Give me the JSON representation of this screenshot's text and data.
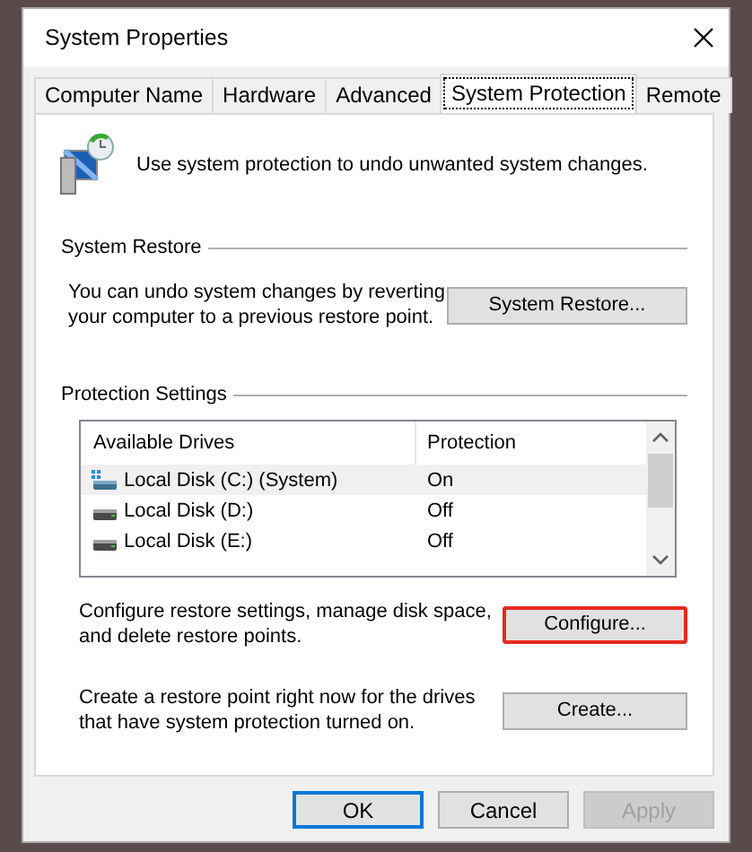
{
  "window": {
    "title": "System Properties"
  },
  "tabs": [
    {
      "label": "Computer Name",
      "selected": false
    },
    {
      "label": "Hardware",
      "selected": false
    },
    {
      "label": "Advanced",
      "selected": false
    },
    {
      "label": "System Protection",
      "selected": true
    },
    {
      "label": "Remote",
      "selected": false
    }
  ],
  "intro": "Use system protection to undo unwanted system changes.",
  "system_restore": {
    "heading": "System Restore",
    "text": "You can undo system changes by reverting your computer to a previous restore point.",
    "button": "System Restore..."
  },
  "protection_settings": {
    "heading": "Protection Settings",
    "columns": [
      "Available Drives",
      "Protection"
    ],
    "rows": [
      {
        "drive": "Local Disk (C:) (System)",
        "protection": "On",
        "kind": "system",
        "selected": true
      },
      {
        "drive": "Local Disk (D:)",
        "protection": "Off",
        "kind": "disk",
        "selected": false
      },
      {
        "drive": "Local Disk (E:)",
        "protection": "Off",
        "kind": "disk",
        "selected": false
      }
    ],
    "actions": [
      {
        "text": "Configure restore settings, manage disk space, and delete restore points.",
        "button": "Configure...",
        "highlighted": true
      },
      {
        "text": "Create a restore point right now for the drives that have system protection turned on.",
        "button": "Create...",
        "highlighted": false
      }
    ]
  },
  "buttons": [
    {
      "label": "OK",
      "default": true,
      "disabled": false
    },
    {
      "label": "Cancel",
      "default": false,
      "disabled": false
    },
    {
      "label": "Apply",
      "default": false,
      "disabled": true
    }
  ]
}
